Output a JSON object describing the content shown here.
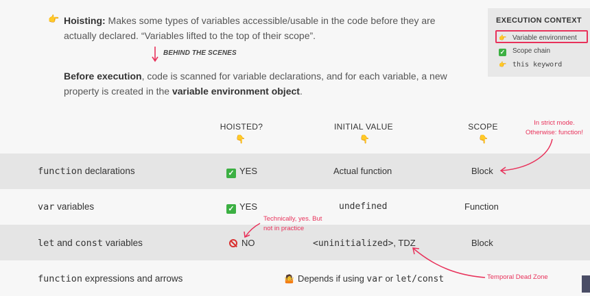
{
  "intro": {
    "bullet_icon": "pointing-hand-icon",
    "hoisting_term": "Hoisting:",
    "hoisting_text": " Makes some types of variables accessible/usable in the code before they are actually declared. “Variables lifted to the top of their scope”.",
    "behind": "BEHIND THE SCENES",
    "before_strong": "Before execution",
    "before_text1": ", code is scanned for variable declarations, and for each variable, a new property is created in the ",
    "before_strong2": "variable environment object",
    "before_text2": "."
  },
  "context": {
    "title": "EXECUTION CONTEXT",
    "items": [
      {
        "icon": "pointing-hand-icon",
        "label": "Variable environment"
      },
      {
        "icon": "check-icon",
        "label": "Scope chain"
      },
      {
        "icon": "pointing-hand-icon",
        "label": "this keyword"
      }
    ]
  },
  "table": {
    "headers": {
      "hoisted": "HOISTED?",
      "initial": "INITIAL VALUE",
      "scope": "SCOPE"
    },
    "rows": [
      {
        "label_code": "function",
        "label_text": " declarations",
        "hoisted": "YES",
        "initial": "Actual function",
        "scope": "Block"
      },
      {
        "label_code": "var",
        "label_text": " variables",
        "hoisted": "YES",
        "initial": "undefined",
        "scope": "Function"
      },
      {
        "label_code1": "let",
        "label_mid": " and ",
        "label_code2": "const",
        "label_text": " variables",
        "hoisted": "NO",
        "initial_code": "<uninitialized>",
        "initial_text": ", TDZ",
        "scope": "Block"
      },
      {
        "label_code": "function",
        "label_text": " expressions and arrows",
        "depends_pre": "Depends if using ",
        "depends_code1": "var",
        "depends_mid": " or ",
        "depends_code2": "let/const"
      }
    ]
  },
  "notes": {
    "strict_line1": "In strict mode.",
    "strict_line2": "Otherwise: function!",
    "tech_line1": "Technically, yes. But",
    "tech_line2": "not in practice",
    "tdz": "Temporal Dead Zone"
  },
  "colors": {
    "accent": "#e8315a",
    "check": "#3cb043"
  }
}
